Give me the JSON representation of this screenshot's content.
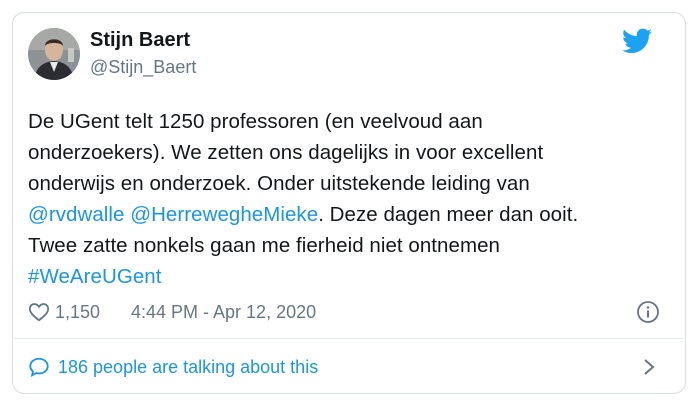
{
  "tweet": {
    "author_name": "Stijn Baert",
    "author_handle": "@Stijn_Baert",
    "text_lines": [
      [
        {
          "t": "De UGent telt 1250 professoren (en veelvoud aan",
          "link": false
        }
      ],
      [
        {
          "t": "onderzoekers). We zetten ons dagelijks in voor excellent",
          "link": false
        }
      ],
      [
        {
          "t": "onderwijs en onderzoek. Onder uitstekende leiding van",
          "link": false
        }
      ],
      [
        {
          "t": "@rvdwalle",
          "link": true
        },
        {
          "t": " ",
          "link": false
        },
        {
          "t": "@HerreweghеMieke",
          "link": true
        },
        {
          "t": ". Deze dagen meer dan ooit.",
          "link": false
        }
      ],
      [
        {
          "t": "Twee zatte nonkels gaan me fierheid niet ontnemen",
          "link": false
        }
      ],
      [
        {
          "t": "#WeAreUGent",
          "link": true
        }
      ]
    ],
    "likes": "1,150",
    "timestamp": "4:44 PM - Apr 12, 2020",
    "talking_label": "186 people are talking about this"
  },
  "colors": {
    "link": "#1b95e0",
    "text": "#14171a",
    "muted": "#657786",
    "border": "#d8dee3",
    "twitter_blue": "#1da1f2"
  },
  "icons": {
    "logo": "twitter-bird-icon",
    "like": "heart-icon",
    "info": "info-icon",
    "talk": "speech-bubble-icon",
    "more": "chevron-right-icon"
  }
}
